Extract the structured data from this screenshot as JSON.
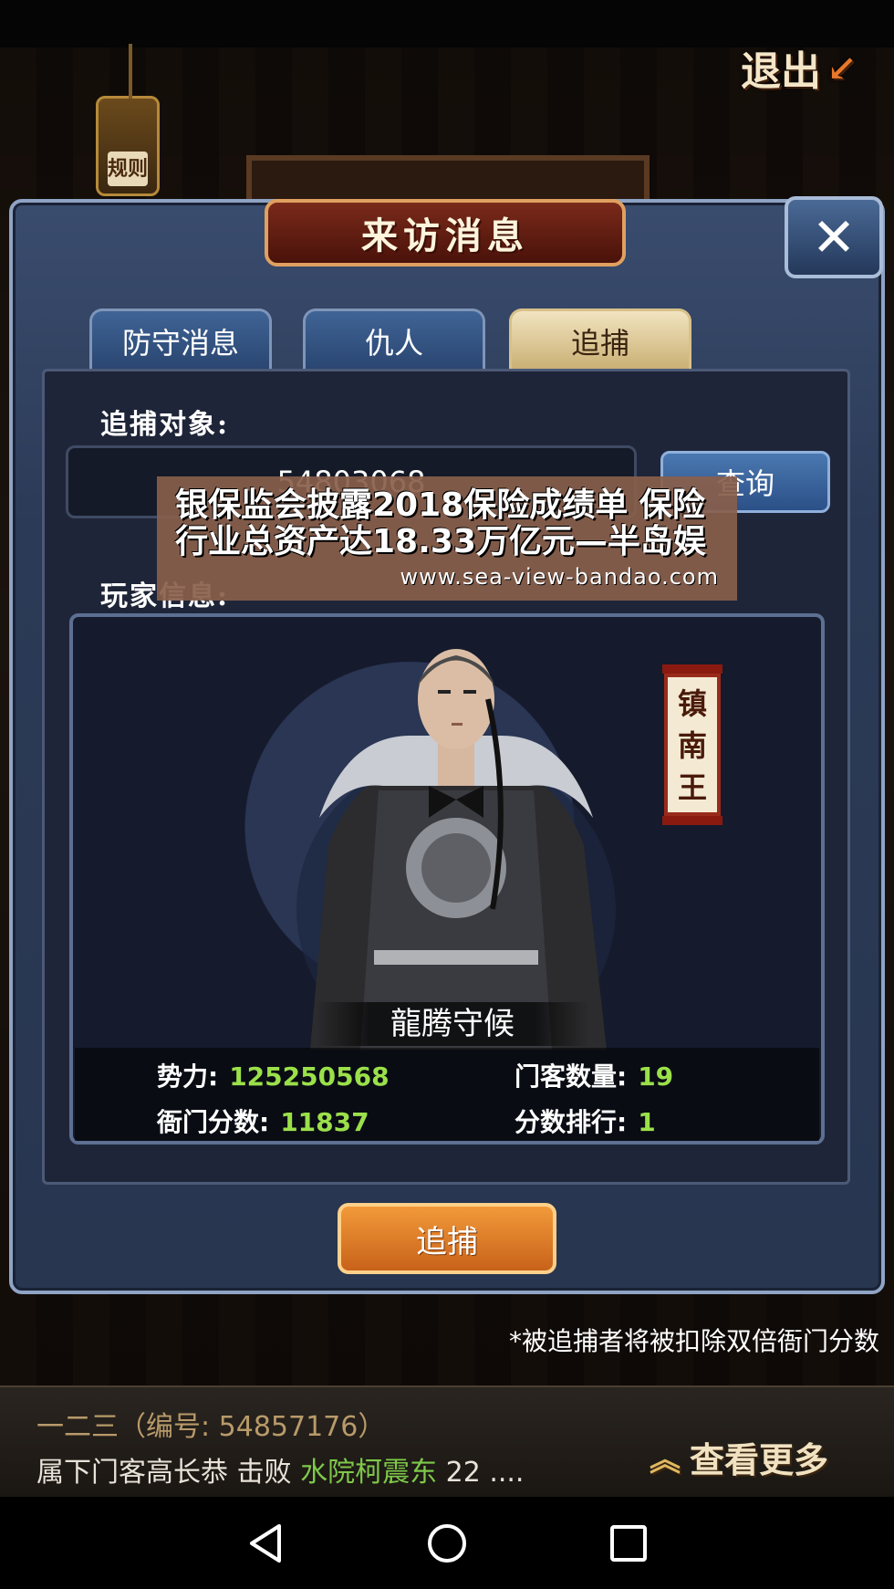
{
  "top_bar": {
    "exit_label": "退出",
    "rules_label": "规则"
  },
  "dialog": {
    "title": "来访消息",
    "close_glyph": "✕",
    "tabs": [
      {
        "label": "防守消息",
        "active": false
      },
      {
        "label": "仇人",
        "active": false
      },
      {
        "label": "追捕",
        "active": true
      }
    ]
  },
  "pursuit": {
    "target_label": "追捕对象:",
    "target_id": "54803068",
    "query_label": "查询",
    "player_info_label": "玩家信息:",
    "title_badge": "镇南王",
    "guard_text": "龍腾守候",
    "stats": {
      "power_label": "势力:",
      "power_value": "125250568",
      "retainers_label": "门客数量:",
      "retainers_value": "19",
      "yamen_score_label": "衙门分数:",
      "yamen_score_value": "11837",
      "rank_label": "分数排行:",
      "rank_value": "1"
    },
    "pursue_button": "追捕",
    "note": "*被追捕者将被扣除双倍衙门分数"
  },
  "ticker": {
    "line1": "一二三（编号: 54857176）",
    "line2_prefix": "属下门客高长恭 击败 ",
    "line2_highlight": "水院柯震东",
    "line2_suffix": " 22 ....",
    "more_label": "查看更多"
  },
  "overlay": {
    "headline": "银保监会披露2018保险成绩单 保险行业总资产达18.33万亿元—半岛娱",
    "url": "www.sea-view-bandao.com"
  },
  "colors": {
    "accent_orange": "#c8621a",
    "stat_value_green": "#9be04a",
    "ticker_highlight": "#7ec84a",
    "dialog_blue": "#2b3a56",
    "overlay_brown": "#895e4b"
  },
  "navigation": {
    "icons": [
      "back-icon",
      "home-icon",
      "recents-icon"
    ]
  }
}
